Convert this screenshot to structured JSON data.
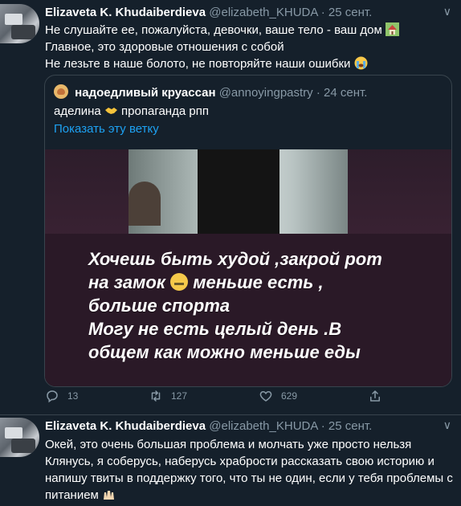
{
  "tweet1": {
    "name": "Elizaveta K. Khudaiberdieva",
    "handle": "@elizabeth_KHUDA",
    "dot": "·",
    "date": "25 сент.",
    "lines": [
      "Не слушайте ее, пожалуйста, девочки, ваше тело - ваш дом",
      "Главное, это здоровые отношения с собой",
      "Не лезьте в наше болото, не повторяйте наши ошибки"
    ],
    "quote": {
      "name": "надоедливый круассан",
      "handle": "@annoyingpastry",
      "dot": "·",
      "date": "24 сент.",
      "text_before": "аделина",
      "text_after": "пропаганда рпп",
      "link": "Показать эту ветку",
      "caption_lines": [
        "Хочешь быть худой ,закрой рот",
        "на замок",
        "меньше есть ,",
        "больше спорта",
        "Могу не есть целый день .В",
        "общем как можно меньше еды"
      ]
    },
    "actions": {
      "replies": "13",
      "retweets": "127",
      "likes": "629"
    }
  },
  "tweet2": {
    "name": "Elizaveta K. Khudaiberdieva",
    "handle": "@elizabeth_KHUDA",
    "dot": "·",
    "date": "25 сент.",
    "text": "Окей, это очень большая проблема и молчать уже просто нельзя Клянусь, я соберусь, наберусь храбрости рассказать свою историю и напишу твиты в поддержку того, что ты не один, если у тебя проблемы с питанием"
  },
  "icons": {
    "house": "house-with-garden-icon",
    "crying": "loudly-crying-face-icon",
    "handshake": "handshake-icon",
    "zipper": "zipper-mouth-face-icon",
    "raised_hands": "raising-hands-icon"
  },
  "colors": {
    "background": "#15202b",
    "border": "#38444d",
    "secondary_text": "#8899a6",
    "link": "#1da1f2"
  }
}
